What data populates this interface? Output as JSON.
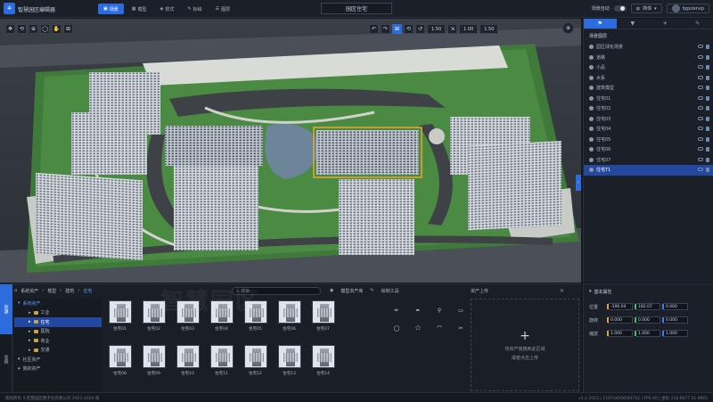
{
  "app": {
    "title": "智慧园区编辑器",
    "logo": "✲"
  },
  "nav": [
    {
      "label": "场景",
      "active": true,
      "icon": "▣"
    },
    {
      "label": "模型",
      "active": false,
      "icon": "▦"
    },
    {
      "label": "样式",
      "active": false,
      "icon": "◈"
    },
    {
      "label": "标绘",
      "active": false,
      "icon": "✎"
    },
    {
      "label": "图层",
      "active": false,
      "icon": "☰"
    }
  ],
  "scene_title": "园区住宅",
  "topright": {
    "toggle_label": "场景自动",
    "lang_label": "简体",
    "user_label": "bgxzenvp"
  },
  "viewport": {
    "toolbar_left": [
      "✥",
      "⟲",
      "⊕",
      "◯",
      "✋",
      "⊞"
    ],
    "toolbar_right_icons": [
      "↶",
      "↷",
      "⊞",
      "⟲",
      "↺",
      "⇲"
    ],
    "values": [
      "1.50",
      "1.00",
      "1.50"
    ],
    "compass": "⊕"
  },
  "rightpanel": {
    "tabs": [
      "⚑",
      "▼",
      "☀",
      "✎"
    ],
    "header": "场景图层",
    "items": [
      {
        "label": "园区绿化场景",
        "selected": false
      },
      {
        "label": "道路",
        "selected": false
      },
      {
        "label": "小品",
        "selected": false
      },
      {
        "label": "水系",
        "selected": false
      },
      {
        "label": "建筑模型",
        "selected": false
      },
      {
        "label": "住宅01",
        "selected": false
      },
      {
        "label": "住宅02",
        "selected": false
      },
      {
        "label": "住宅03",
        "selected": false
      },
      {
        "label": "住宅04",
        "selected": false
      },
      {
        "label": "住宅05",
        "selected": false
      },
      {
        "label": "住宅06",
        "selected": false
      },
      {
        "label": "住宅07",
        "selected": false
      },
      {
        "label": "住宅T1",
        "selected": true
      }
    ]
  },
  "assets": {
    "sidetabs": [
      "资源",
      "收藏"
    ],
    "breadcrumb": [
      "系统资产",
      "模型",
      "建筑",
      "住宅"
    ],
    "search_placeholder": "搜索",
    "tree": [
      {
        "label": "系统资产",
        "level": 0,
        "head": true
      },
      {
        "label": "工业",
        "level": 1
      },
      {
        "label": "住宅",
        "level": 1,
        "selected": true
      },
      {
        "label": "医院",
        "level": 1
      },
      {
        "label": "商业",
        "level": 1
      },
      {
        "label": "交通",
        "level": 1
      },
      {
        "label": "社区资产",
        "level": 0
      },
      {
        "label": "我的资产",
        "level": 0
      }
    ],
    "thumbs": [
      "住宅01",
      "住宅02",
      "住宅03",
      "住宅04",
      "住宅05",
      "住宅06",
      "住宅07",
      "住宅08",
      "住宅09",
      "住宅10",
      "住宅11",
      "住宅12",
      "住宅13",
      "住宅14"
    ],
    "section_tools": "绘制工具",
    "section_visible": "模型资产库",
    "section_upload": "资产上传",
    "upload_hint1": "将资产拖拽到此区域",
    "upload_hint2": "或者点击上传",
    "tools": [
      "✏",
      "✒",
      "⚲",
      "▭",
      "◯",
      "⬠",
      "⌒",
      "✂"
    ]
  },
  "properties": {
    "header": "基本属性",
    "rows": [
      {
        "label": "位置",
        "x": "-196.04",
        "y": "182.07",
        "z": "0.000"
      },
      {
        "label": "旋转",
        "x": "0.000",
        "y": "0.000",
        "z": "0.000"
      },
      {
        "label": "缩放",
        "x": "1.000",
        "y": "1.000",
        "z": "1.000"
      }
    ]
  },
  "statusbar": {
    "left": "版权所有 ©智慧园区数字化有限公司 2021-2024 版",
    "right": "v1.2.2023 | 1107/06/00/04742 | FPS 60 | 坐标 118.0877 31.9865"
  },
  "watermark": "智慧园区"
}
